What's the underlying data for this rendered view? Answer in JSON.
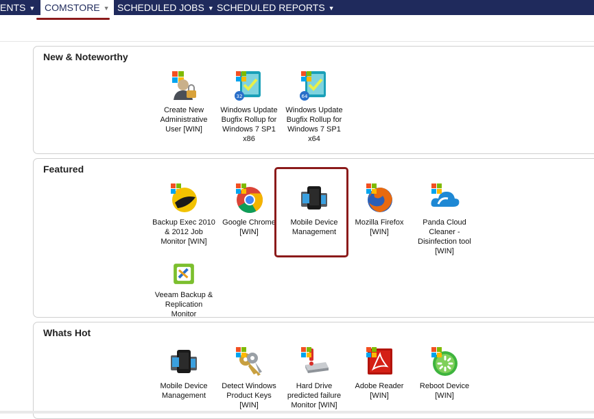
{
  "nav": {
    "items": [
      {
        "label": "ENTS"
      },
      {
        "label": "COMSTORE"
      },
      {
        "label": "SCHEDULED JOBS"
      },
      {
        "label": "SCHEDULED REPORTS"
      }
    ]
  },
  "sections": {
    "new_noteworthy": {
      "title": "New & Noteworthy",
      "tiles": [
        {
          "label": "Create New Administrative User [WIN]",
          "icon": "admin-user-icon"
        },
        {
          "label": "Windows Update Bugfix Rollup for Windows 7 SP1 x86",
          "icon": "windows-update-icon"
        },
        {
          "label": "Windows Update Bugfix Rollup for Windows 7 SP1 x64",
          "icon": "windows-update-icon"
        }
      ]
    },
    "featured": {
      "title": "Featured",
      "tiles": [
        {
          "label": "Backup Exec 2010 & 2012 Job Monitor [WIN]",
          "icon": "backup-exec-icon"
        },
        {
          "label": "Google Chrome [WIN]",
          "icon": "chrome-icon"
        },
        {
          "label": "Mobile Device Management",
          "icon": "mobile-device-icon"
        },
        {
          "label": "Mozilla Firefox [WIN]",
          "icon": "firefox-icon"
        },
        {
          "label": "Panda Cloud Cleaner - Disinfection tool [WIN]",
          "icon": "panda-cloud-icon"
        },
        {
          "label": "Veeam Backup & Replication Monitor",
          "icon": "veeam-icon"
        }
      ]
    },
    "whats_hot": {
      "title": "Whats Hot",
      "tiles": [
        {
          "label": "Mobile Device Management",
          "icon": "mobile-device-icon"
        },
        {
          "label": "Detect Windows Product Keys [WIN]",
          "icon": "product-keys-icon"
        },
        {
          "label": "Hard Drive predicted failure Monitor [WIN]",
          "icon": "hard-drive-icon"
        },
        {
          "label": "Adobe Reader [WIN]",
          "icon": "adobe-reader-icon"
        },
        {
          "label": "Reboot Device [WIN]",
          "icon": "reboot-icon"
        }
      ]
    }
  },
  "colors": {
    "nav_bg": "#1f2a5c",
    "highlight": "#8b1a1a"
  }
}
